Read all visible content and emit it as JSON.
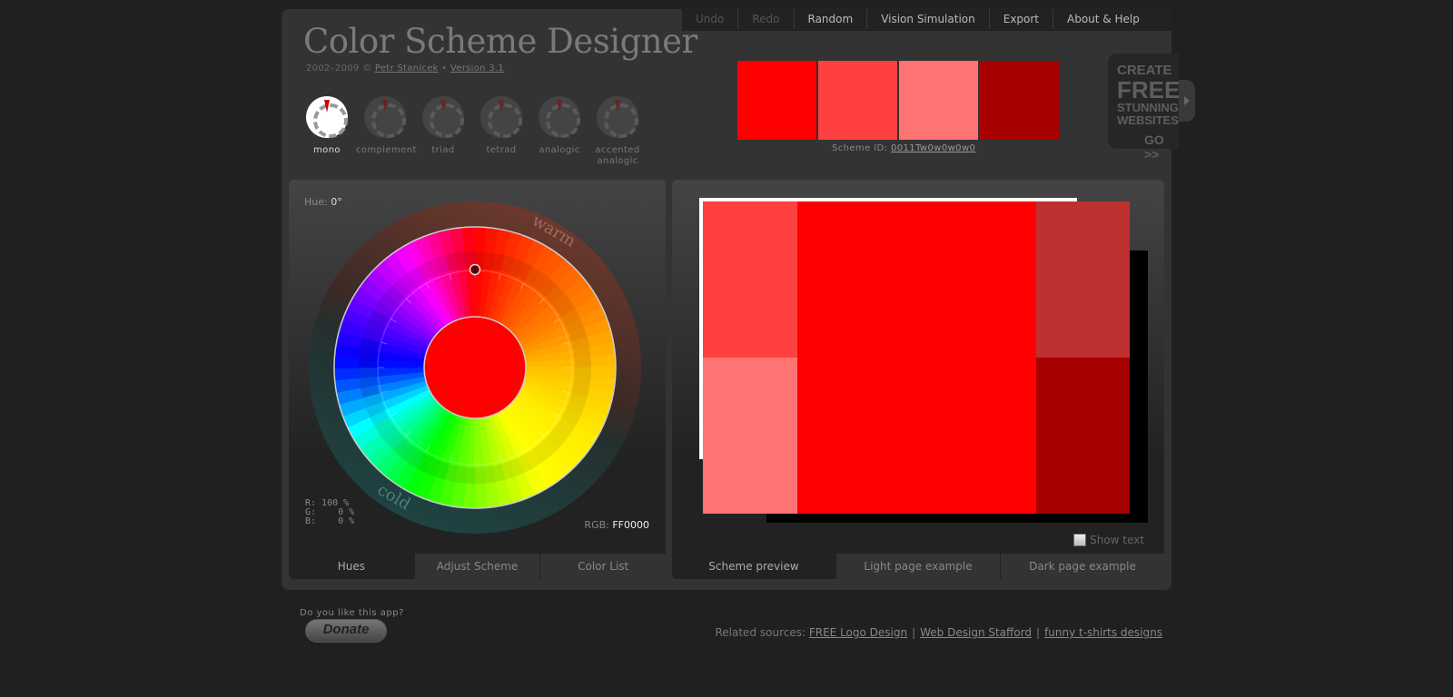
{
  "app": {
    "title": "Color Scheme Designer",
    "copyright_prefix": "2002–2009 © ",
    "author": "Petr Stanicek",
    "separator": " • ",
    "version": "Version 3.1"
  },
  "topnav": [
    {
      "label": "Undo",
      "disabled": true
    },
    {
      "label": "Redo",
      "disabled": true
    },
    {
      "label": "Random",
      "disabled": false
    },
    {
      "label": "Vision Simulation",
      "disabled": false
    },
    {
      "label": "Export",
      "disabled": false
    },
    {
      "label": "About & Help",
      "disabled": false
    }
  ],
  "scheme_types": [
    {
      "label": "mono",
      "active": true
    },
    {
      "label": "complement",
      "active": false
    },
    {
      "label": "triad",
      "active": false
    },
    {
      "label": "tetrad",
      "active": false
    },
    {
      "label": "analogic",
      "active": false
    },
    {
      "label": "accented analogic",
      "active": false
    }
  ],
  "palette": {
    "swatches": [
      "#FF0000",
      "#FF4040",
      "#FF7373",
      "#A60000"
    ],
    "scheme_id_label": "Scheme ID: ",
    "scheme_id": "0011Tw0w0w0w0"
  },
  "ad": {
    "line1": "CREATE",
    "line2": "FREE",
    "line3": "STUNNING",
    "line4": "WEBSITES",
    "go": "GO >>"
  },
  "hues_panel": {
    "hue_label": "Hue: ",
    "hue_value": "0°",
    "warm_label": "warm",
    "cold_label": "cold",
    "rgb_percent": "R: 100 %\nG:    0 %\nB:    0 %",
    "rgb_label": "RGB: ",
    "rgb_hex": "FF0000",
    "center_color": "#FF0000",
    "selected_hue_deg": 0,
    "tabs": [
      {
        "label": "Hues",
        "active": true
      },
      {
        "label": "Adjust Scheme",
        "active": false
      },
      {
        "label": "Color List",
        "active": false
      }
    ]
  },
  "preview_panel": {
    "colors": {
      "main": "#FF0000",
      "top_left": "#FF4040",
      "bottom_left": "#FF7373",
      "top_right": "#BF3030",
      "bottom_right": "#A60000"
    },
    "show_text_label": "Show text",
    "show_text_checked": false,
    "tabs": [
      {
        "label": "Scheme preview",
        "active": true
      },
      {
        "label": "Light page example",
        "active": false
      },
      {
        "label": "Dark page example",
        "active": false
      }
    ]
  },
  "footer": {
    "like_text": "Do you like this app?",
    "donate_label": "Donate",
    "related_label": "Related sources: ",
    "related_links": [
      "FREE Logo Design",
      "Web Design Stafford",
      "funny t-shirts designs"
    ]
  }
}
